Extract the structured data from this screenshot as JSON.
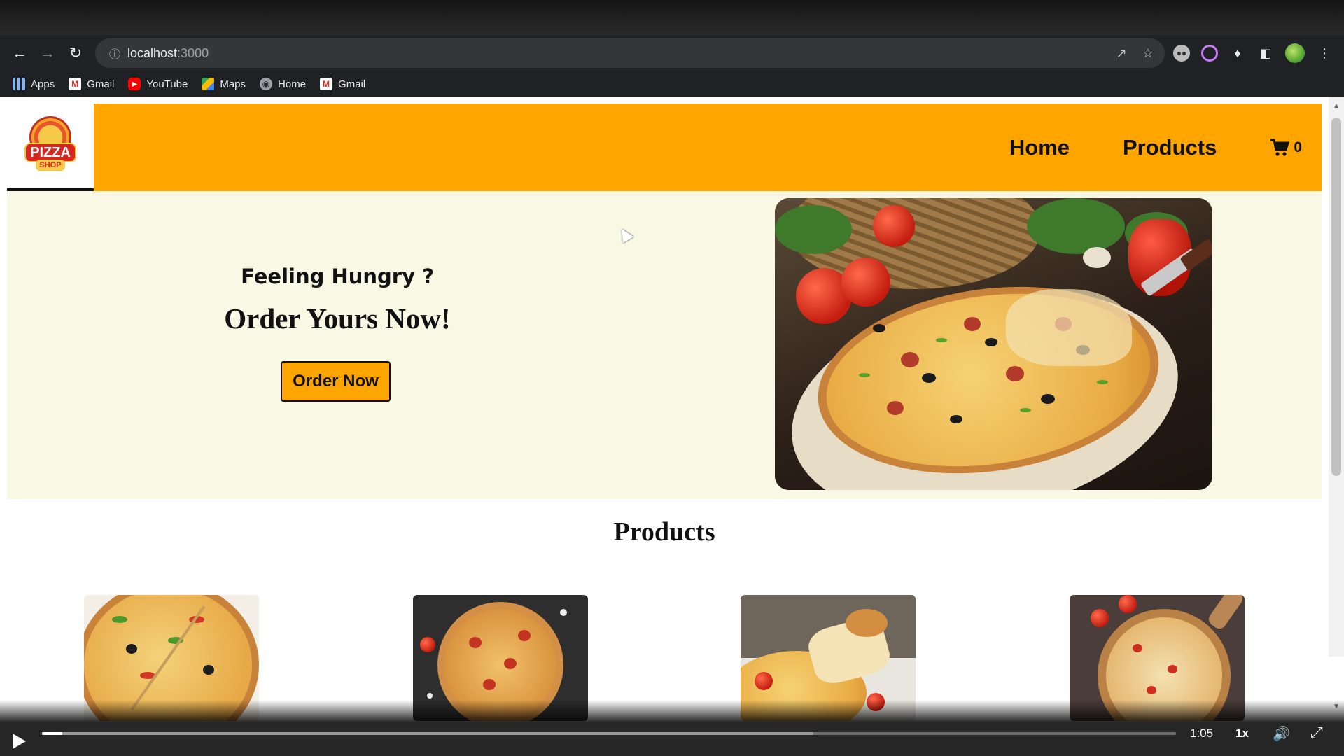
{
  "browser": {
    "url_host": "localhost",
    "url_port": ":3000",
    "bookmarks": [
      {
        "label": "Apps",
        "icon": "apps-icon"
      },
      {
        "label": "Gmail",
        "icon": "gmail-icon"
      },
      {
        "label": "YouTube",
        "icon": "youtube-icon"
      },
      {
        "label": "Maps",
        "icon": "maps-icon"
      },
      {
        "label": "Home",
        "icon": "globe-icon"
      },
      {
        "label": "Gmail",
        "icon": "gmail-icon"
      }
    ]
  },
  "site": {
    "logo": {
      "word": "PIZZA",
      "sub": "SHOP"
    },
    "nav": {
      "home": "Home",
      "products": "Products"
    },
    "cart_count": "0",
    "accent": "#ffa500",
    "hero_bg": "#f8f8e5"
  },
  "hero": {
    "subtitle": "Feeling Hungry ?",
    "title": "Order Yours Now!",
    "button": "Order Now"
  },
  "products": {
    "heading": "Products",
    "count_visible": 4
  },
  "player": {
    "time": "1:05",
    "speed": "1x",
    "progress": 0.018
  }
}
